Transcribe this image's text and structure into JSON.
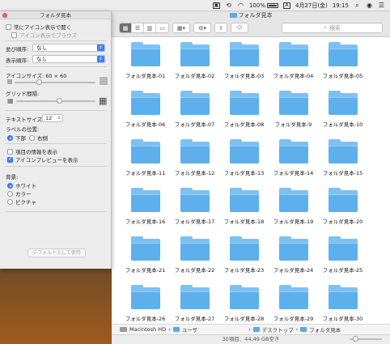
{
  "menubar": {
    "battery": "100%",
    "input_method": "A",
    "date": "4月27日(金)",
    "time": "19:15"
  },
  "finder": {
    "window_title": "フォルダ見本",
    "search_placeholder": "検索",
    "folders": [
      "フォルダ見本-01",
      "フォルダ見本-02",
      "フォルダ見本-03",
      "フォルダ見本-04",
      "フォルダ見本-05",
      "フォルダ見本-06",
      "フォルダ見本-07",
      "フォルダ見本-08",
      "フォルダ見本-9",
      "フォルダ見本-10",
      "フォルダ見本-11",
      "フォルダ見本-12",
      "フォルダ見本-13",
      "フォルダ見本-14",
      "フォルダ見本-15",
      "フォルダ見本-16",
      "フォルダ見本-17",
      "フォルダ見本-18",
      "フォルダ見本-19",
      "フォルダ見本-20",
      "フォルダ見本-21",
      "フォルダ見本-22",
      "フォルダ見本-23",
      "フォルダ見本-24",
      "フォルダ見本-25",
      "フォルダ見本-26",
      "フォルダ見本-27",
      "フォルダ見本-28",
      "フォルダ見本-29",
      "フォルダ見本-30"
    ],
    "path": [
      "Macintosh HD",
      "ユーザ",
      "デスクトップ",
      "フォルダ見本"
    ],
    "status": "30項目、44.49 GB空き"
  },
  "panel": {
    "title": "フォルダ見本",
    "always_icon_view": "常にアイコン表示で開く",
    "browse_icon_view": "アイコン表示でブラウズ",
    "arrange_label": "並び順序:",
    "arrange_value": "なし",
    "sort_label": "表示順序:",
    "sort_value": "なし",
    "icon_size_label": "アイコンサイズ: 60 × 60",
    "icon_size_fraction": 0.3,
    "grid_spacing_label": "グリッド間隔:",
    "grid_spacing_fraction": 0.55,
    "text_size_label": "テキストサイズ:",
    "text_size_value": "12",
    "label_position_label": "ラベルの位置:",
    "label_bottom": "下部",
    "label_right": "右側",
    "show_item_info": "項目の情報を表示",
    "show_icon_preview": "アイコンプレビューを表示",
    "background_label": "背景:",
    "bg_white": "ホワイト",
    "bg_color": "カラー",
    "bg_picture": "ピクチャ",
    "default_button": "デフォルトとして使用"
  },
  "colors": {
    "folder": "#5eb0ec",
    "accent": "#3b82f6"
  }
}
